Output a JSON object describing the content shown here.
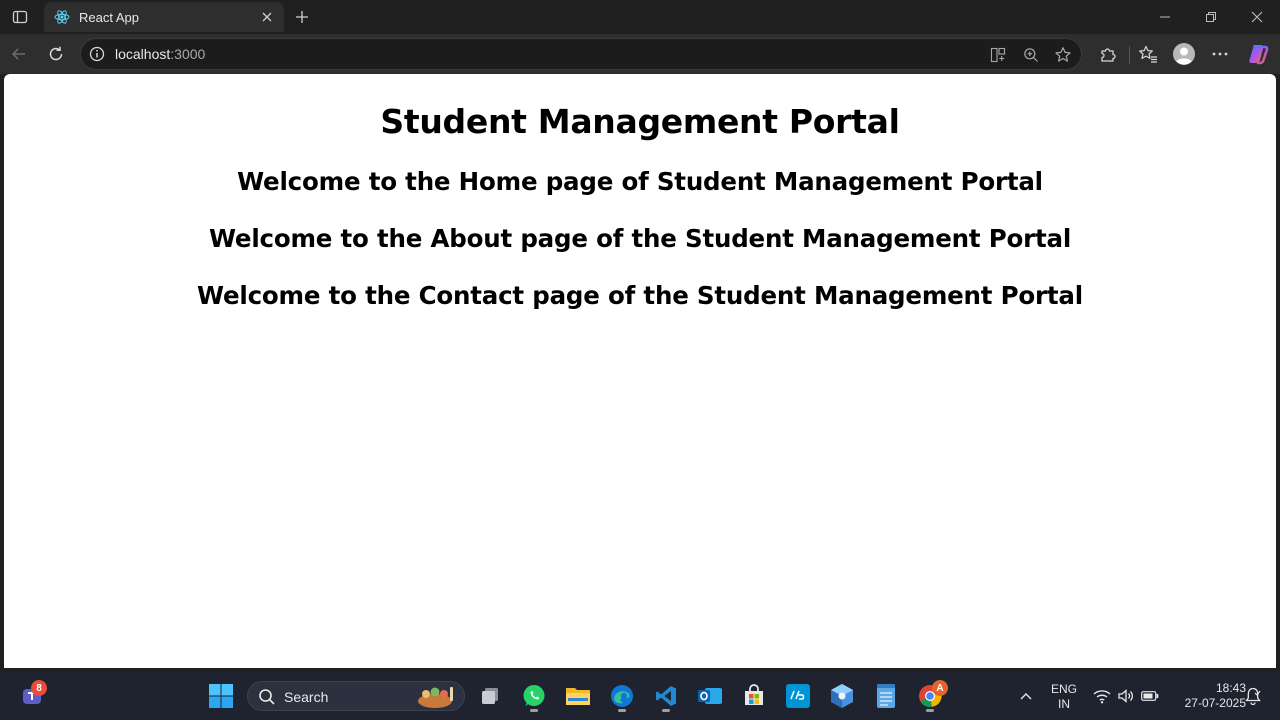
{
  "browser": {
    "tab": {
      "title": "React App",
      "favicon": "react-logo-icon"
    },
    "omnibox": {
      "host": "localhost",
      "port": ":3000"
    },
    "icons": [
      "sidebar-toggle-icon",
      "close-icon",
      "plus-icon",
      "minimize-icon",
      "restore-icon",
      "back-arrow-icon",
      "reload-icon",
      "info-icon",
      "app-available-icon",
      "zoom-icon",
      "star-icon",
      "extensions-icon",
      "favorites-icon",
      "profile-icon",
      "more-icon",
      "copilot-icon"
    ]
  },
  "page": {
    "title": "Student Management Portal",
    "home": "Welcome to the Home page of Student Management Portal",
    "about": "Welcome to the About page of the Student Management Portal",
    "contact": "Welcome to the Contact page of the Student Management Portal"
  },
  "taskbar": {
    "search_placeholder": "Search",
    "chat_badge": "8",
    "chrome_badge": "A",
    "apps": [
      "teams-icon",
      "windows-start-icon",
      "task-view-icon",
      "whatsapp-icon",
      "file-explorer-icon",
      "edge-icon",
      "vscode-icon",
      "outlook-icon",
      "store-icon",
      "myhp-icon",
      "app-cube-icon",
      "notepad-icon",
      "chrome-icon"
    ],
    "tray": {
      "lang_top": "ENG",
      "lang_bottom": "IN",
      "time": "18:43",
      "date": "27-07-2025"
    }
  },
  "colors": {
    "chrome_bg": "#202020",
    "toolbar_bg": "#2e2e2e",
    "taskbar_bg": "#1f2330",
    "page_bg": "#ffffff",
    "page_text": "#000000"
  }
}
